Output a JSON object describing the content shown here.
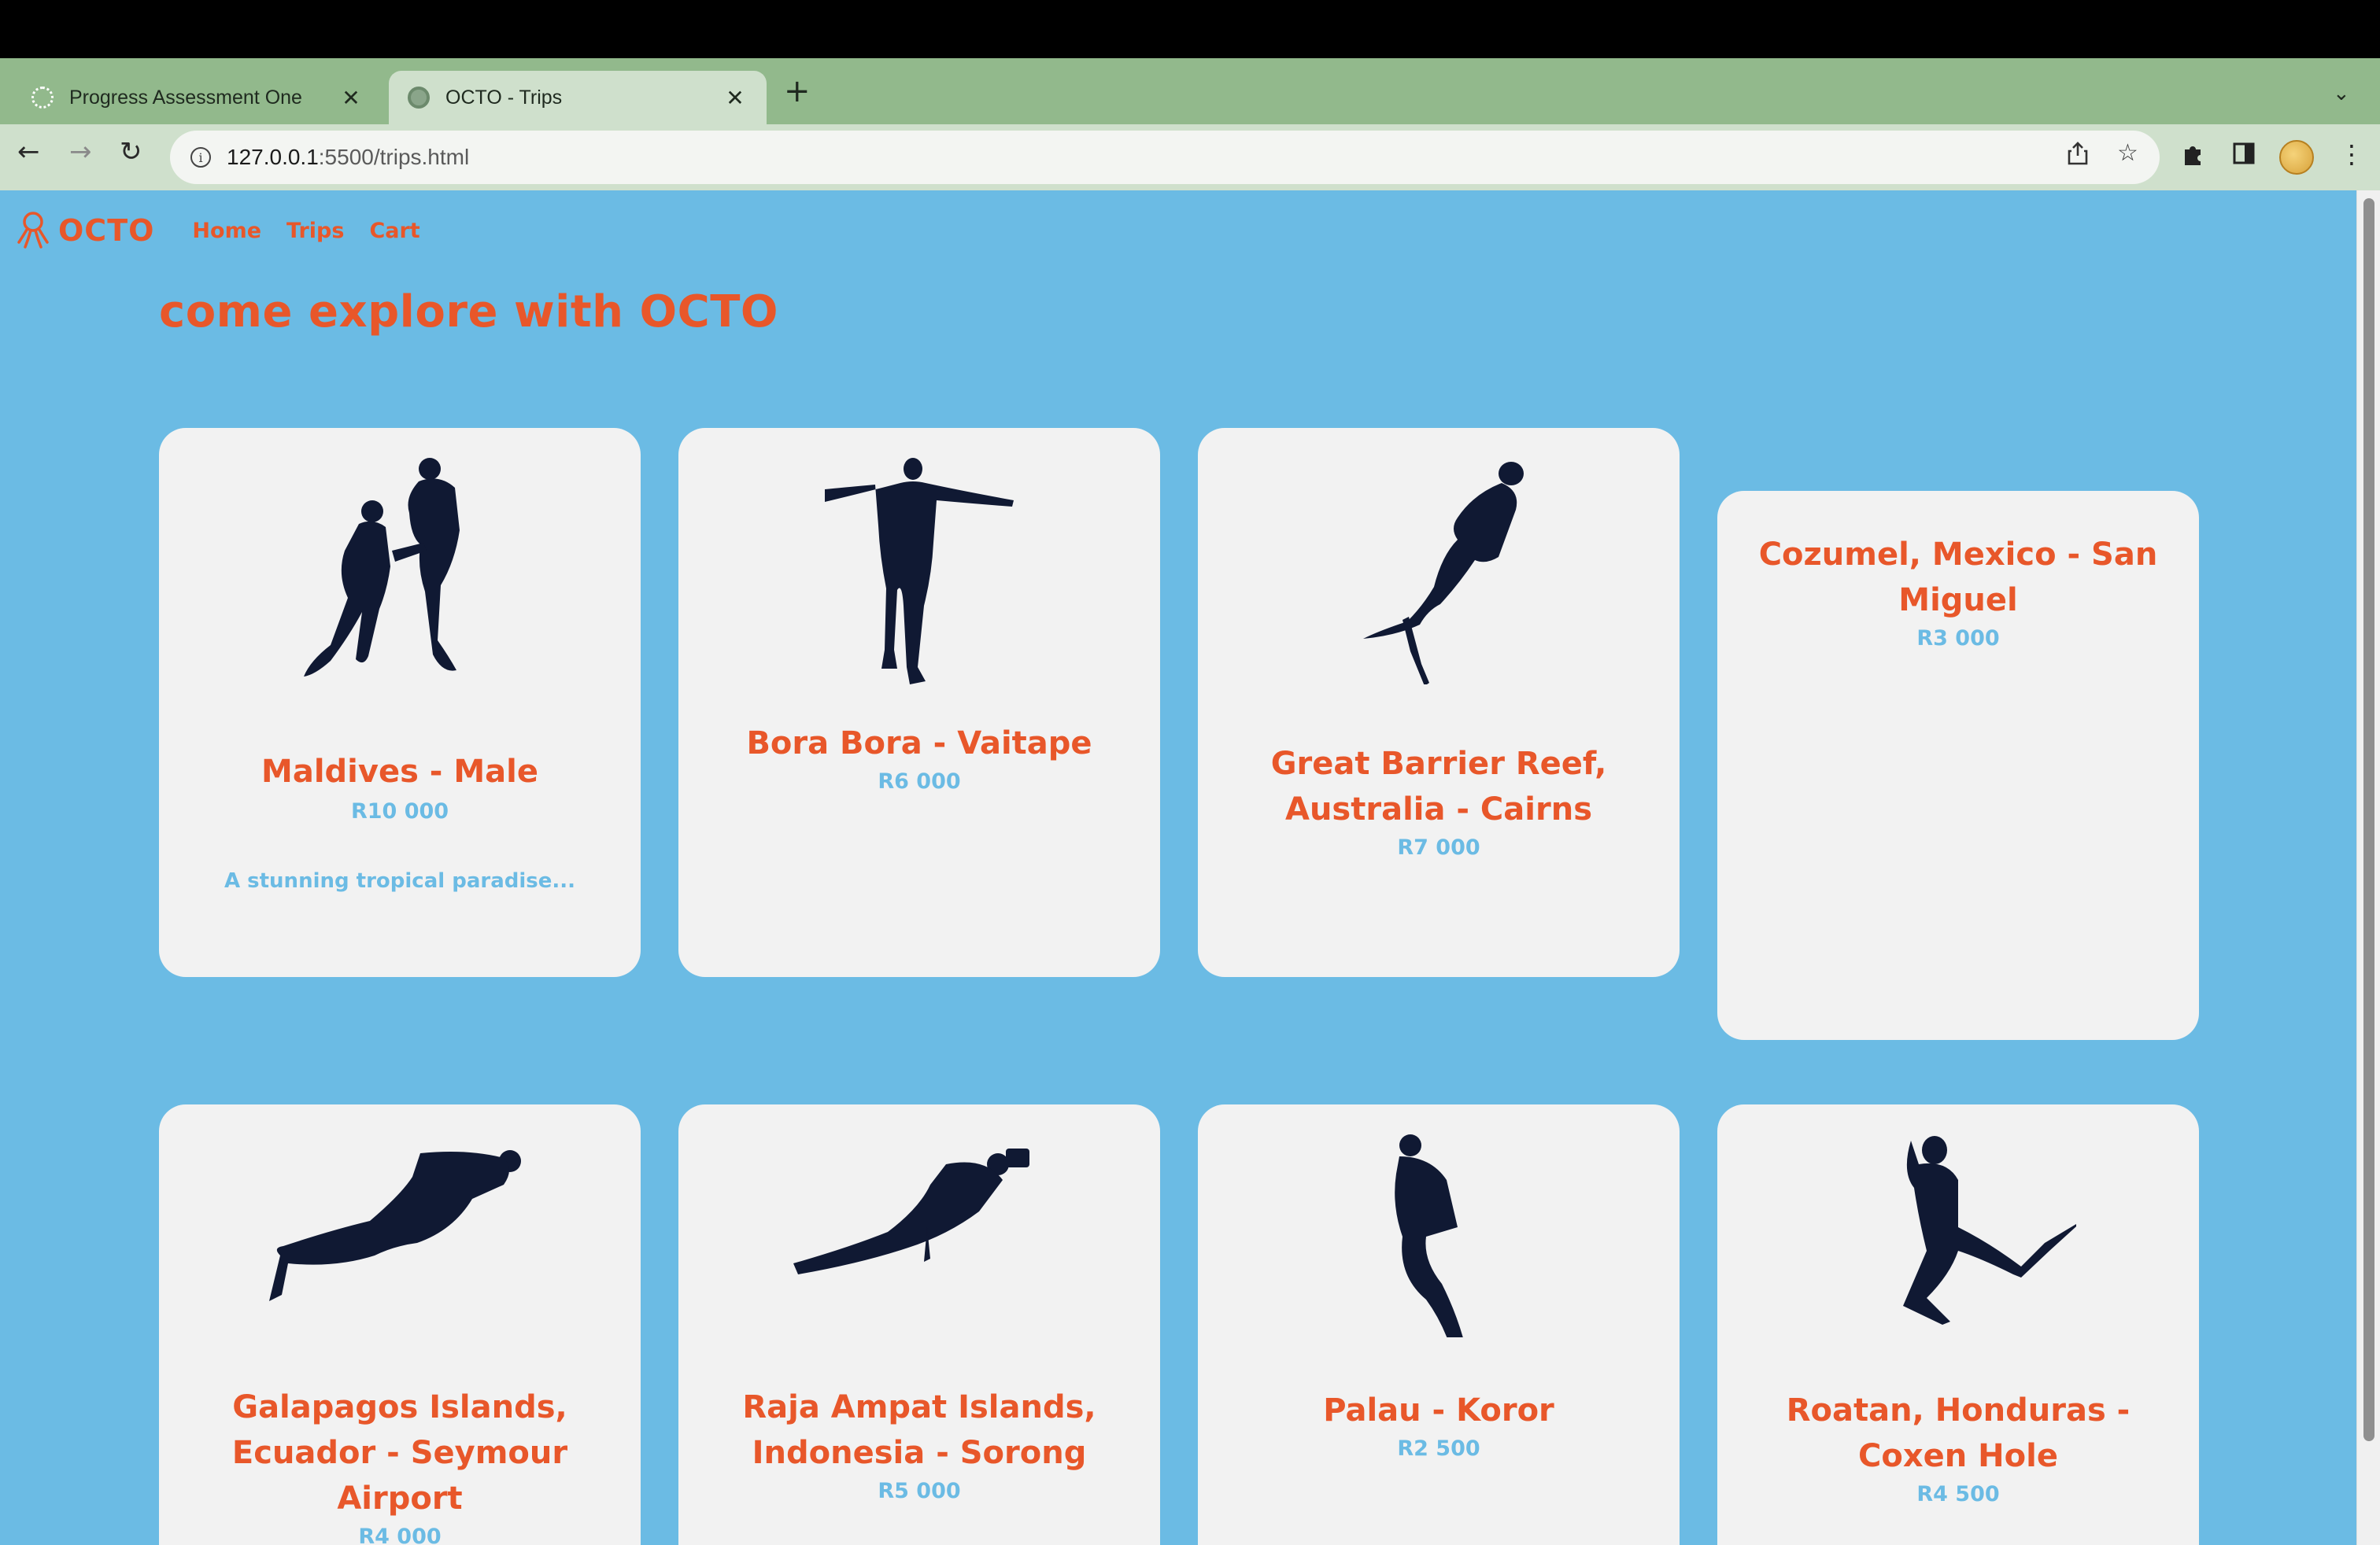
{
  "browser": {
    "tabs": [
      {
        "title": "Progress Assessment One",
        "active": false
      },
      {
        "title": "OCTO - Trips",
        "active": true
      }
    ],
    "new_tab_label": "+",
    "url_host": "127.0.0.1",
    "url_path": ":5500/trips.html",
    "tab_close_glyph": "✕"
  },
  "site": {
    "logo_text": "OCTO",
    "nav": [
      "Home",
      "Trips",
      "Cart"
    ],
    "hero": "come explore with OCTO",
    "accent_color": "#e8572a",
    "background_color": "#6bbbe4",
    "card_color": "#f2f2f2"
  },
  "trips": [
    {
      "name": "Maldives - Male",
      "price": "R10 000",
      "description": "A stunning tropical paradise...",
      "icon": "two-divers-silhouette"
    },
    {
      "name": "Bora Bora - Vaitape",
      "price": "R6 000",
      "icon": "diver-arms-out-silhouette"
    },
    {
      "name": "Great Barrier Reef, Australia - Cairns",
      "price": "R7 000",
      "icon": "diver-swimming-silhouette"
    },
    {
      "name": "Cozumel, Mexico - San Miguel",
      "price": "R3 000",
      "icon": ""
    },
    {
      "name": "Galapagos Islands, Ecuador - Seymour Airport",
      "price": "R4 000",
      "icon": "diver-horizontal-silhouette"
    },
    {
      "name": "Raja Ampat Islands, Indonesia - Sorong",
      "price": "R5 000",
      "icon": "diver-camera-silhouette"
    },
    {
      "name": "Palau - Koror",
      "price": "R2 500",
      "icon": "diver-descending-silhouette"
    },
    {
      "name": "Roatan, Honduras - Coxen Hole",
      "price": "R4 500",
      "icon": "diver-kicking-silhouette"
    }
  ]
}
